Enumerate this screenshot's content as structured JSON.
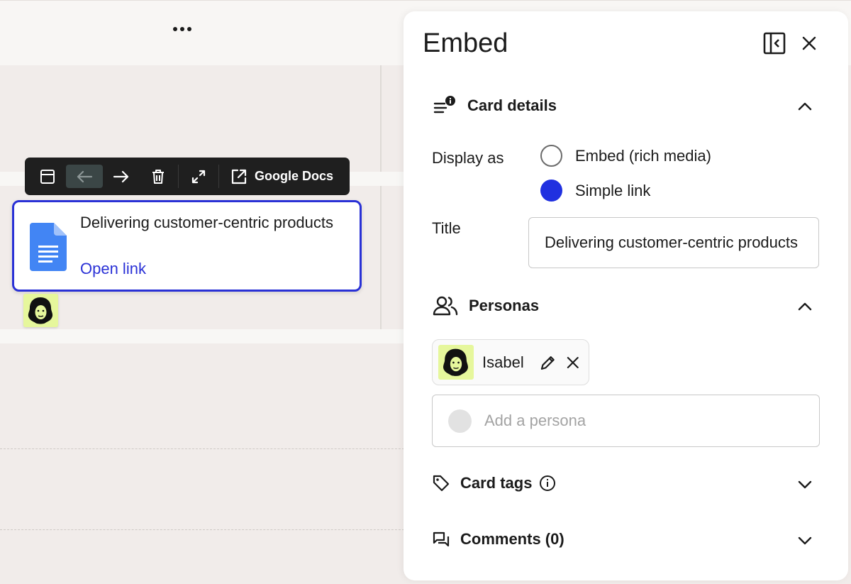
{
  "toolbar": {
    "label": "Google Docs"
  },
  "card": {
    "title": "Delivering customer-centric products",
    "link_label": "Open link"
  },
  "panel": {
    "title": "Embed",
    "card_details": {
      "heading": "Card details",
      "display_as_label": "Display as",
      "options": [
        {
          "label": "Embed (rich media)",
          "selected": false
        },
        {
          "label": "Simple link",
          "selected": true
        }
      ],
      "title_label": "Title",
      "title_value": "Delivering customer-centric products"
    },
    "personas": {
      "heading": "Personas",
      "items": [
        {
          "name": "Isabel"
        }
      ],
      "add_placeholder": "Add a persona"
    },
    "card_tags": {
      "heading": "Card tags"
    },
    "comments": {
      "heading": "Comments (0)"
    }
  },
  "colors": {
    "accent": "#2a31d6",
    "radio_selected": "#2030e0",
    "persona_avatar_bg": "#e6f79c",
    "toolbar_bg": "#1f1f1f",
    "canvas_bg": "#f1ecea"
  },
  "icons": [
    "more-horizontal-icon",
    "card-view-icon",
    "arrow-left-icon",
    "arrow-right-icon",
    "trash-icon",
    "expand-icon",
    "external-link-icon",
    "google-docs-icon",
    "collapse-panel-icon",
    "close-icon",
    "card-details-icon",
    "chevron-up-icon",
    "people-icon",
    "pencil-icon",
    "tag-icon",
    "info-icon",
    "comments-icon",
    "chevron-down-icon"
  ]
}
